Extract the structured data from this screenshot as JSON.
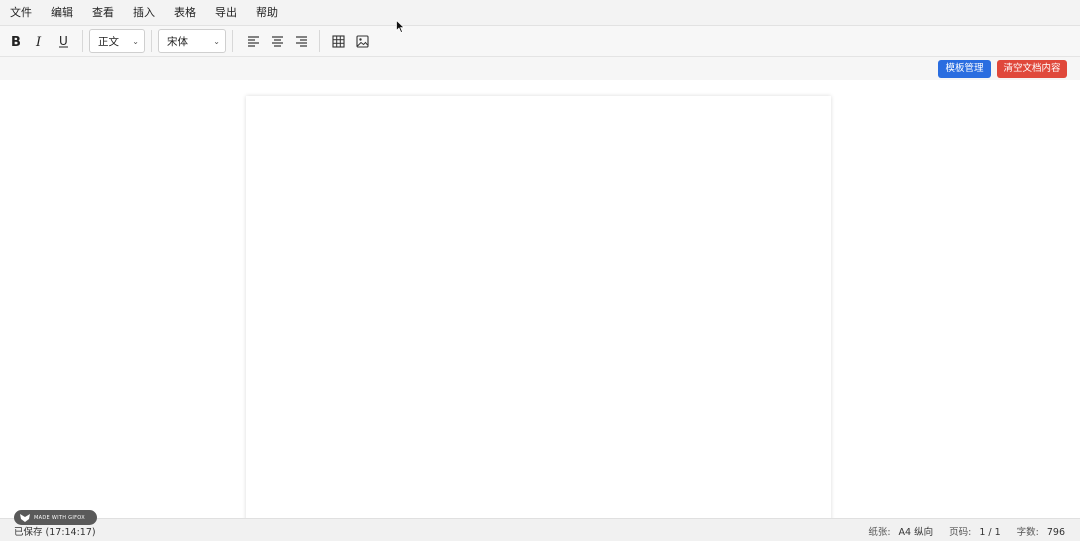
{
  "menu": [
    "文件",
    "编辑",
    "查看",
    "插入",
    "表格",
    "导出",
    "帮助"
  ],
  "toolbar": {
    "bold_icon": "bold-icon",
    "italic_icon": "italic-icon",
    "underline_icon": "underline-icon",
    "style_select": "正文",
    "font_select": "宋体",
    "align_left_icon": "align-left-icon",
    "align_center_icon": "align-center-icon",
    "align_right_icon": "align-right-icon",
    "table_icon": "table-icon",
    "image_icon": "image-icon"
  },
  "actions": {
    "template_button": "模板管理",
    "clear_button": "清空文档内容"
  },
  "status": {
    "saved": "已保存 (17:14:17)",
    "paper_label": "纸张:",
    "paper_value": "A4 纵向",
    "pages_label": "页码:",
    "pages_value": "1 / 1",
    "words_label": "字数:",
    "words_value": "796"
  },
  "badge": {
    "text": "MADE WITH GIFOX"
  },
  "colors": {
    "primary": "#2a6de0",
    "danger": "#e0483b"
  }
}
